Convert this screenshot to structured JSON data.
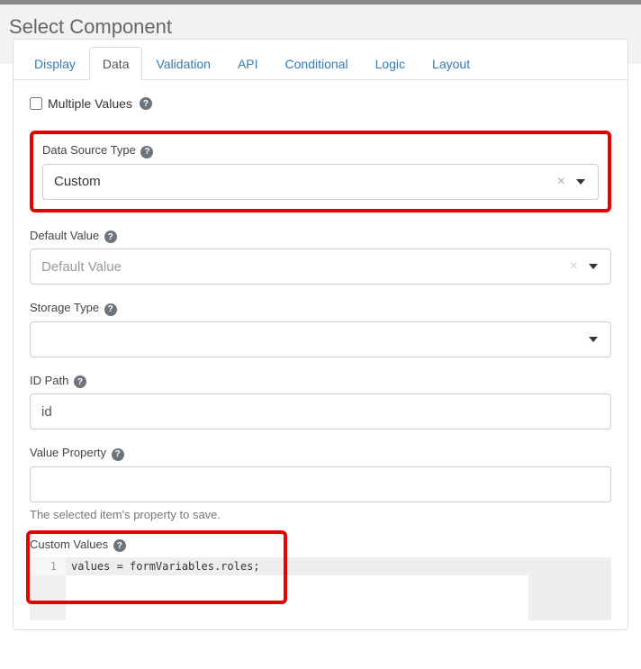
{
  "header": {
    "title": "Select Component"
  },
  "tabs": [
    {
      "label": "Display",
      "active": false
    },
    {
      "label": "Data",
      "active": true
    },
    {
      "label": "Validation",
      "active": false
    },
    {
      "label": "API",
      "active": false
    },
    {
      "label": "Conditional",
      "active": false
    },
    {
      "label": "Logic",
      "active": false
    },
    {
      "label": "Layout",
      "active": false
    }
  ],
  "multiple_values": {
    "label": "Multiple Values",
    "checked": false
  },
  "data_source_type": {
    "label": "Data Source Type",
    "value": "Custom"
  },
  "default_value": {
    "label": "Default Value",
    "placeholder": "Default Value"
  },
  "storage_type": {
    "label": "Storage Type",
    "value": ""
  },
  "id_path": {
    "label": "ID Path",
    "value": "id"
  },
  "value_property": {
    "label": "Value Property",
    "value": "",
    "helper": "The selected item's property to save."
  },
  "custom_values": {
    "label": "Custom Values",
    "line_no": "1",
    "code": "values = formVariables.roles;"
  },
  "icons": {
    "help": "?",
    "clear": "×"
  }
}
